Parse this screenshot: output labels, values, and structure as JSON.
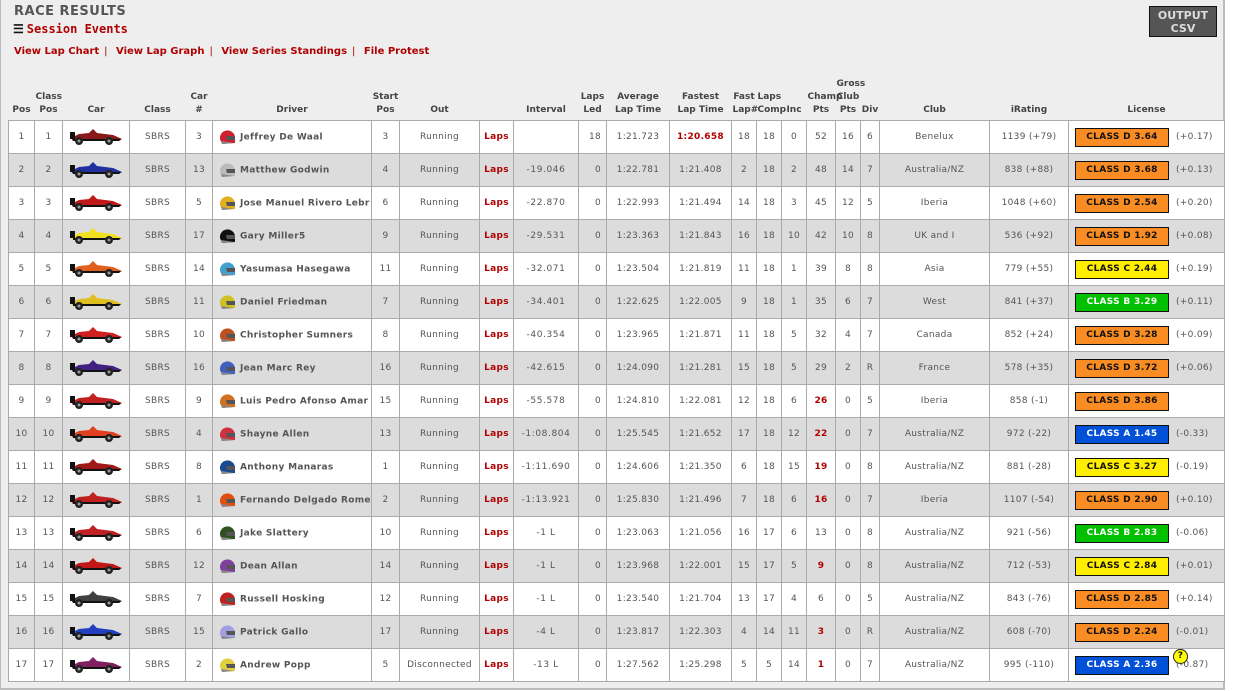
{
  "header": {
    "title": "RACE RESULTS",
    "session_events": "Session Events",
    "list_icon": "list-icon",
    "output_csv": [
      "OUTPUT",
      "CSV"
    ]
  },
  "links": [
    "View Lap Chart",
    "View Lap Graph",
    "View Series Standings",
    "File Protest"
  ],
  "columns": [
    [
      "Pos"
    ],
    [
      "Class",
      "Pos"
    ],
    [
      "Car"
    ],
    [
      "Class"
    ],
    [
      "Car #"
    ],
    [
      "Driver"
    ],
    [
      "Start",
      "Pos"
    ],
    [
      "Out"
    ],
    [
      ""
    ],
    [
      "Interval"
    ],
    [
      "Laps",
      "Led"
    ],
    [
      "Average",
      "Lap Time"
    ],
    [
      "Fastest",
      "Lap Time"
    ],
    [
      "Fast",
      "Lap#"
    ],
    [
      "Laps",
      "Comp"
    ],
    [
      "Inc"
    ],
    [
      "Champ",
      "Pts"
    ],
    [
      "Gross",
      "Club",
      "Pts"
    ],
    [
      "Div"
    ],
    [
      "Club"
    ],
    [
      "iRating"
    ],
    [
      "License"
    ]
  ],
  "license_colors": {
    "A": "#0050d8",
    "B": "#00c000",
    "C": "#ffee00",
    "D": "#f98c22"
  },
  "rows": [
    {
      "pos": "1",
      "cpos": "1",
      "car_color": "#8a1a1a",
      "class": "SBRS",
      "num": "3",
      "driver": "Jeffrey De Waal",
      "helmet": "#d02030",
      "start": "3",
      "out": "Running",
      "laps_link": "Laps",
      "interval": "",
      "led": "18",
      "avg": "1:21.723",
      "fast": "1:20.658",
      "fast_red": true,
      "fastlap": "18",
      "comp": "18",
      "inc": "0",
      "champ": "52",
      "champ_red": false,
      "gross": "16",
      "div": "6",
      "club": "Benelux",
      "irating": "1139 (+79)",
      "license": "CLASS D 3.64",
      "lic_class": "D",
      "lic_chg": "(+0.17)"
    },
    {
      "pos": "2",
      "cpos": "2",
      "car_color": "#2030a0",
      "class": "SBRS",
      "num": "13",
      "driver": "Matthew Godwin",
      "helmet": "#bbbbbb",
      "start": "4",
      "out": "Running",
      "laps_link": "Laps",
      "interval": "-19.046",
      "led": "0",
      "avg": "1:22.781",
      "fast": "1:21.408",
      "fastlap": "2",
      "comp": "18",
      "inc": "2",
      "champ": "48",
      "gross": "14",
      "div": "7",
      "club": "Australia/NZ",
      "irating": "838 (+88)",
      "license": "CLASS D 3.68",
      "lic_class": "D",
      "lic_chg": "(+0.13)"
    },
    {
      "pos": "3",
      "cpos": "3",
      "car_color": "#c01818",
      "class": "SBRS",
      "num": "5",
      "driver": "Jose Manuel Rivero Lebr",
      "helmet": "#e0b020",
      "start": "6",
      "out": "Running",
      "laps_link": "Laps",
      "interval": "-22.870",
      "led": "0",
      "avg": "1:22.993",
      "fast": "1:21.494",
      "fastlap": "14",
      "comp": "18",
      "inc": "3",
      "champ": "45",
      "gross": "12",
      "div": "5",
      "club": "Iberia",
      "irating": "1048 (+60)",
      "license": "CLASS D 2.54",
      "lic_class": "D",
      "lic_chg": "(+0.20)"
    },
    {
      "pos": "4",
      "cpos": "4",
      "car_color": "#f0e020",
      "class": "SBRS",
      "num": "17",
      "driver": "Gary Miller5",
      "helmet": "#111111",
      "start": "9",
      "out": "Running",
      "laps_link": "Laps",
      "interval": "-29.531",
      "led": "0",
      "avg": "1:23.363",
      "fast": "1:21.843",
      "fastlap": "16",
      "comp": "18",
      "inc": "10",
      "champ": "42",
      "gross": "10",
      "div": "8",
      "club": "UK and I",
      "irating": "536 (+92)",
      "license": "CLASS D 1.92",
      "lic_class": "D",
      "lic_chg": "(+0.08)"
    },
    {
      "pos": "5",
      "cpos": "5",
      "car_color": "#e06020",
      "class": "SBRS",
      "num": "14",
      "driver": "Yasumasa Hasegawa",
      "helmet": "#40a0d0",
      "start": "11",
      "out": "Running",
      "laps_link": "Laps",
      "interval": "-32.071",
      "led": "0",
      "avg": "1:23.504",
      "fast": "1:21.819",
      "fastlap": "11",
      "comp": "18",
      "inc": "1",
      "champ": "39",
      "gross": "8",
      "div": "8",
      "club": "Asia",
      "irating": "779 (+55)",
      "license": "CLASS C 2.44",
      "lic_class": "C",
      "lic_chg": "(+0.19)"
    },
    {
      "pos": "6",
      "cpos": "6",
      "car_color": "#e0c020",
      "class": "SBRS",
      "num": "11",
      "driver": "Daniel Friedman",
      "helmet": "#d0c020",
      "start": "7",
      "out": "Running",
      "laps_link": "Laps",
      "interval": "-34.401",
      "led": "0",
      "avg": "1:22.625",
      "fast": "1:22.005",
      "fastlap": "9",
      "comp": "18",
      "inc": "1",
      "champ": "35",
      "gross": "6",
      "div": "7",
      "club": "West",
      "irating": "841 (+37)",
      "license": "CLASS B 3.29",
      "lic_class": "B",
      "lic_chg": "(+0.11)"
    },
    {
      "pos": "7",
      "cpos": "7",
      "car_color": "#d02020",
      "class": "SBRS",
      "num": "10",
      "driver": "Christopher Sumners",
      "helmet": "#c05020",
      "start": "8",
      "out": "Running",
      "laps_link": "Laps",
      "interval": "-40.354",
      "led": "0",
      "avg": "1:23.965",
      "fast": "1:21.871",
      "fastlap": "11",
      "comp": "18",
      "inc": "5",
      "champ": "32",
      "gross": "4",
      "div": "7",
      "club": "Canada",
      "irating": "852 (+24)",
      "license": "CLASS D 3.28",
      "lic_class": "D",
      "lic_chg": "(+0.09)"
    },
    {
      "pos": "8",
      "cpos": "8",
      "car_color": "#402080",
      "class": "SBRS",
      "num": "16",
      "driver": "Jean Marc Rey",
      "helmet": "#4060c0",
      "start": "16",
      "out": "Running",
      "laps_link": "Laps",
      "interval": "-42.615",
      "led": "0",
      "avg": "1:24.090",
      "fast": "1:21.281",
      "fastlap": "15",
      "comp": "18",
      "inc": "5",
      "champ": "29",
      "gross": "2",
      "div": "R",
      "club": "France",
      "irating": "578 (+35)",
      "license": "CLASS D 3.72",
      "lic_class": "D",
      "lic_chg": "(+0.06)"
    },
    {
      "pos": "9",
      "cpos": "9",
      "car_color": "#c02020",
      "class": "SBRS",
      "num": "9",
      "driver": "Luis Pedro Afonso Amar",
      "helmet": "#d07020",
      "start": "15",
      "out": "Running",
      "laps_link": "Laps",
      "interval": "-55.578",
      "led": "0",
      "avg": "1:24.810",
      "fast": "1:22.081",
      "fastlap": "12",
      "comp": "18",
      "inc": "6",
      "champ": "26",
      "champ_red": true,
      "gross": "0",
      "div": "5",
      "club": "Iberia",
      "irating": "858 (-1)",
      "license": "CLASS D 3.86",
      "lic_class": "D",
      "lic_chg": ""
    },
    {
      "pos": "10",
      "cpos": "10",
      "car_color": "#e04020",
      "class": "SBRS",
      "num": "4",
      "driver": "Shayne Allen",
      "helmet": "#d03040",
      "start": "13",
      "out": "Running",
      "laps_link": "Laps",
      "interval": "-1:08.804",
      "led": "0",
      "avg": "1:25.545",
      "fast": "1:21.652",
      "fastlap": "17",
      "comp": "18",
      "inc": "12",
      "champ": "22",
      "champ_red": true,
      "gross": "0",
      "div": "7",
      "club": "Australia/NZ",
      "irating": "972 (-22)",
      "license": "CLASS A 1.45",
      "lic_class": "A",
      "lic_chg": "(-0.33)"
    },
    {
      "pos": "11",
      "cpos": "11",
      "car_color": "#a01818",
      "class": "SBRS",
      "num": "8",
      "driver": "Anthony Manaras",
      "helmet": "#1a4a90",
      "start": "1",
      "out": "Running",
      "laps_link": "Laps",
      "interval": "-1:11.690",
      "led": "0",
      "avg": "1:24.606",
      "fast": "1:21.350",
      "fastlap": "6",
      "comp": "18",
      "inc": "15",
      "champ": "19",
      "champ_red": true,
      "gross": "0",
      "div": "8",
      "club": "Australia/NZ",
      "irating": "881 (-28)",
      "license": "CLASS C 3.27",
      "lic_class": "C",
      "lic_chg": "(-0.19)"
    },
    {
      "pos": "12",
      "cpos": "12",
      "car_color": "#c02020",
      "class": "SBRS",
      "num": "1",
      "driver": "Fernando Delgado Rome",
      "helmet": "#e05010",
      "start": "2",
      "out": "Running",
      "laps_link": "Laps",
      "interval": "-1:13.921",
      "led": "0",
      "avg": "1:25.830",
      "fast": "1:21.496",
      "fastlap": "7",
      "comp": "18",
      "inc": "6",
      "champ": "16",
      "champ_red": true,
      "gross": "0",
      "div": "7",
      "club": "Iberia",
      "irating": "1107 (-54)",
      "license": "CLASS D 2.90",
      "lic_class": "D",
      "lic_chg": "(+0.10)"
    },
    {
      "pos": "13",
      "cpos": "13",
      "car_color": "#c02020",
      "class": "SBRS",
      "num": "6",
      "driver": "Jake Slattery",
      "helmet": "#305020",
      "start": "10",
      "out": "Running",
      "laps_link": "Laps",
      "interval": "-1 L",
      "led": "0",
      "avg": "1:23.063",
      "fast": "1:21.056",
      "fastlap": "16",
      "comp": "17",
      "inc": "6",
      "champ": "13",
      "gross": "0",
      "div": "8",
      "club": "Australia/NZ",
      "irating": "921 (-56)",
      "license": "CLASS B 2.83",
      "lic_class": "B",
      "lic_chg": "(-0.06)"
    },
    {
      "pos": "14",
      "cpos": "14",
      "car_color": "#c01818",
      "class": "SBRS",
      "num": "12",
      "driver": "Dean Allan",
      "helmet": "#8040a0",
      "start": "14",
      "out": "Running",
      "laps_link": "Laps",
      "interval": "-1 L",
      "led": "0",
      "avg": "1:23.968",
      "fast": "1:22.001",
      "fastlap": "15",
      "comp": "17",
      "inc": "5",
      "champ": "9",
      "champ_red": true,
      "gross": "0",
      "div": "8",
      "club": "Australia/NZ",
      "irating": "712 (-53)",
      "license": "CLASS C 2.84",
      "lic_class": "C",
      "lic_chg": "(+0.01)"
    },
    {
      "pos": "15",
      "cpos": "15",
      "car_color": "#404040",
      "class": "SBRS",
      "num": "7",
      "driver": "Russell Hosking",
      "helmet": "#c02020",
      "start": "12",
      "out": "Running",
      "laps_link": "Laps",
      "interval": "-1 L",
      "led": "0",
      "avg": "1:23.540",
      "fast": "1:21.704",
      "fastlap": "13",
      "comp": "17",
      "inc": "4",
      "champ": "6",
      "gross": "0",
      "div": "5",
      "club": "Australia/NZ",
      "irating": "843 (-76)",
      "license": "CLASS D 2.85",
      "lic_class": "D",
      "lic_chg": "(+0.14)"
    },
    {
      "pos": "16",
      "cpos": "16",
      "car_color": "#2040c0",
      "class": "SBRS",
      "num": "15",
      "driver": "Patrick Gallo",
      "helmet": "#a0a0e0",
      "start": "17",
      "out": "Running",
      "laps_link": "Laps",
      "interval": "-4 L",
      "led": "0",
      "avg": "1:23.817",
      "fast": "1:22.303",
      "fastlap": "4",
      "comp": "14",
      "inc": "11",
      "champ": "3",
      "champ_red": true,
      "gross": "0",
      "div": "R",
      "club": "Australia/NZ",
      "irating": "608 (-70)",
      "license": "CLASS D 2.24",
      "lic_class": "D",
      "lic_chg": "(-0.01)"
    },
    {
      "pos": "17",
      "cpos": "17",
      "car_color": "#802060",
      "class": "SBRS",
      "num": "2",
      "driver": "Andrew Popp",
      "helmet": "#e0d040",
      "start": "5",
      "out": "Disconnected",
      "laps_link": "Laps",
      "interval": "-13 L",
      "led": "0",
      "avg": "1:27.562",
      "fast": "1:25.298",
      "fastlap": "5",
      "comp": "5",
      "inc": "14",
      "champ": "1",
      "champ_red": true,
      "gross": "0",
      "div": "7",
      "club": "Australia/NZ",
      "irating": "995 (-110)",
      "license": "CLASS A 2.36",
      "lic_class": "A",
      "lic_chg": "(-0.87)",
      "help_icon": "?"
    }
  ]
}
